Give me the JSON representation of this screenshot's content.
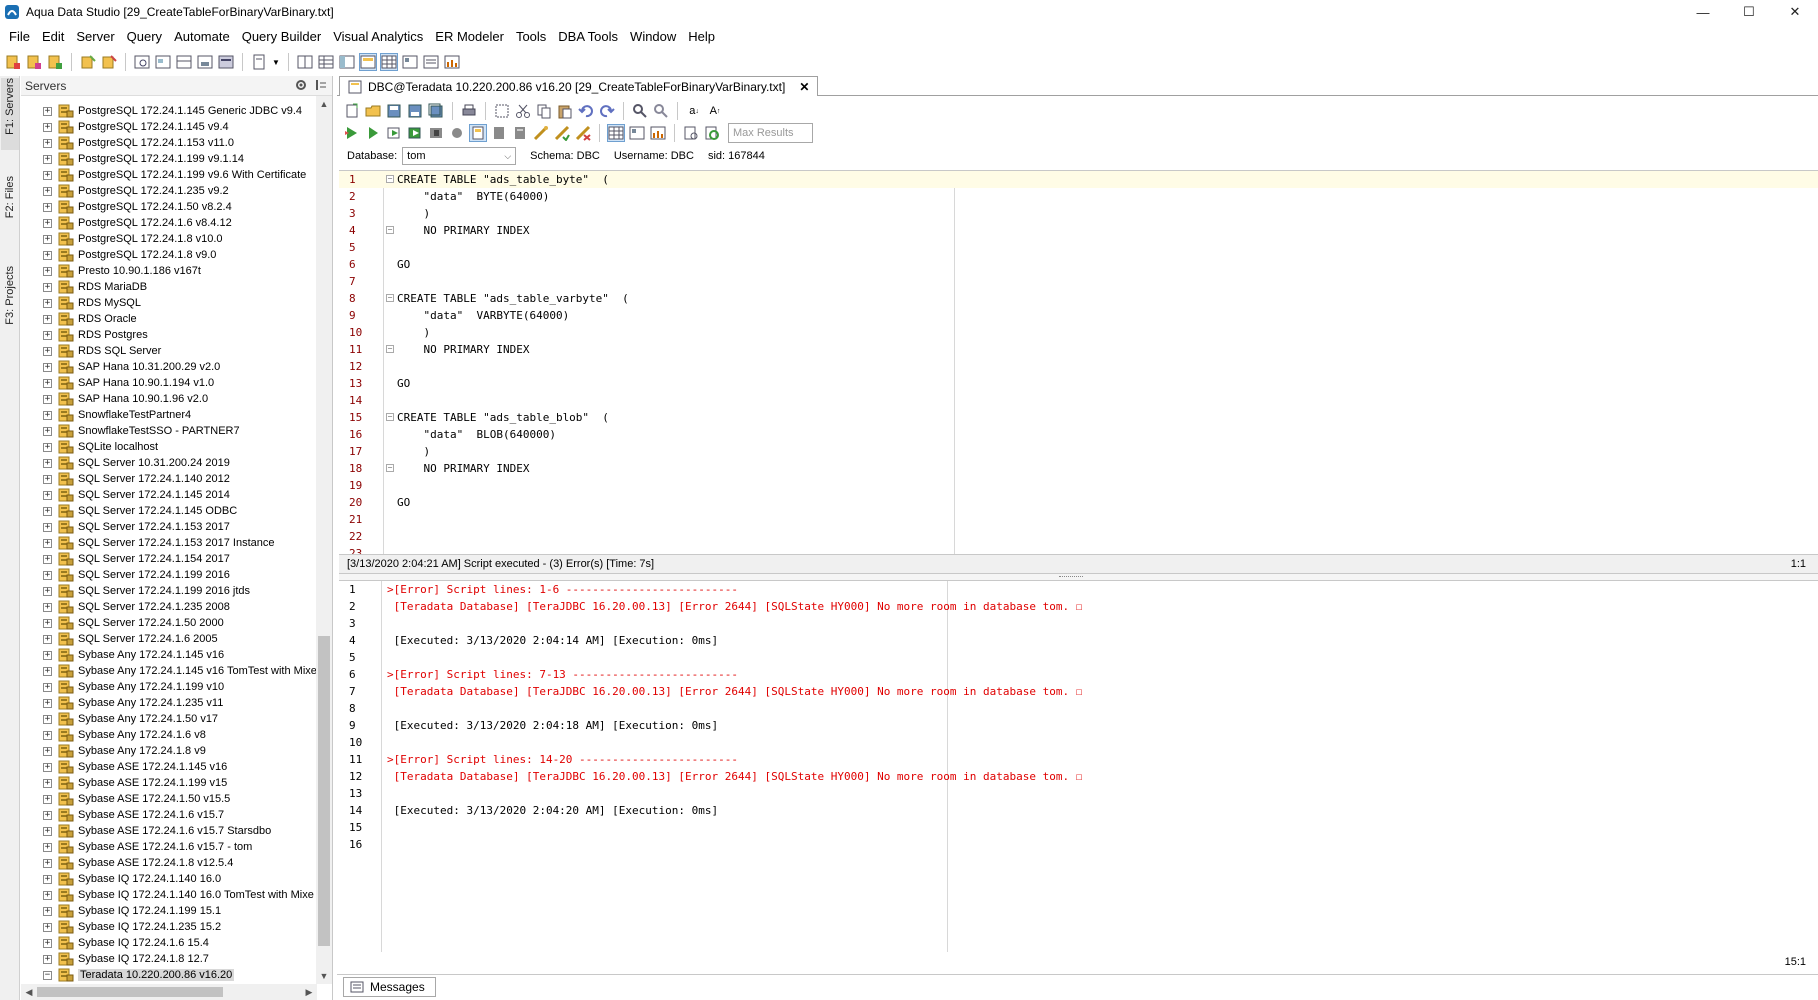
{
  "window": {
    "title": "Aqua Data Studio [29_CreateTableForBinaryVarBinary.txt]",
    "controls": {
      "minimize": "—",
      "maximize": "☐",
      "close": "✕"
    }
  },
  "menu": [
    "File",
    "Edit",
    "Server",
    "Query",
    "Automate",
    "Query Builder",
    "Visual Analytics",
    "ER Modeler",
    "Tools",
    "DBA Tools",
    "Window",
    "Help"
  ],
  "side_tabs": {
    "servers": "F1: Servers",
    "files": "F2: Files",
    "projects": "F3: Projects"
  },
  "servers_panel": {
    "title": "Servers",
    "items": [
      "PostgreSQL 172.24.1.145 Generic JDBC v9.4",
      "PostgreSQL 172.24.1.145 v9.4",
      "PostgreSQL 172.24.1.153 v11.0",
      "PostgreSQL 172.24.1.199 v9.1.14",
      "PostgreSQL 172.24.1.199 v9.6 With Certificate",
      "PostgreSQL 172.24.1.235 v9.2",
      "PostgreSQL 172.24.1.50 v8.2.4",
      "PostgreSQL 172.24.1.6 v8.4.12",
      "PostgreSQL 172.24.1.8 v10.0",
      "PostgreSQL 172.24.1.8 v9.0",
      "Presto 10.90.1.186 v167t",
      "RDS MariaDB",
      "RDS MySQL",
      "RDS Oracle",
      "RDS Postgres",
      "RDS SQL Server",
      "SAP Hana 10.31.200.29 v2.0",
      "SAP Hana 10.90.1.194 v1.0",
      "SAP Hana 10.90.1.96 v2.0",
      "SnowflakeTestPartner4",
      "SnowflakeTestSSO - PARTNER7",
      "SQLite localhost",
      "SQL Server 10.31.200.24 2019",
      "SQL Server 172.24.1.140 2012",
      "SQL Server 172.24.1.145 2014",
      "SQL Server 172.24.1.145 ODBC",
      "SQL Server 172.24.1.153 2017",
      "SQL Server 172.24.1.153 2017 Instance",
      "SQL Server 172.24.1.154 2017",
      "SQL Server 172.24.1.199 2016",
      "SQL Server 172.24.1.199 2016 jtds",
      "SQL Server 172.24.1.235 2008",
      "SQL Server 172.24.1.50 2000",
      "SQL Server 172.24.1.6 2005",
      "Sybase Any 172.24.1.145 v16",
      "Sybase Any 172.24.1.145 v16 TomTest with Mixe",
      "Sybase Any 172.24.1.199 v10",
      "Sybase Any 172.24.1.235 v11",
      "Sybase Any 172.24.1.50 v17",
      "Sybase Any 172.24.1.6 v8",
      "Sybase Any 172.24.1.8 v9",
      "Sybase ASE 172.24.1.145 v16",
      "Sybase ASE 172.24.1.199 v15",
      "Sybase ASE 172.24.1.50 v15.5",
      "Sybase ASE 172.24.1.6 v15.7",
      "Sybase ASE 172.24.1.6 v15.7 Starsdbo",
      "Sybase ASE 172.24.1.6 v15.7 - tom",
      "Sybase ASE 172.24.1.8 v12.5.4",
      "Sybase IQ 172.24.1.140 16.0",
      "Sybase IQ 172.24.1.140 16.0 TomTest with Mixe",
      "Sybase IQ 172.24.1.199 15.1",
      "Sybase IQ 172.24.1.235 15.2",
      "Sybase IQ 172.24.1.6 15.4",
      "Sybase IQ 172.24.1.8 12.7",
      "Teradata 10.220.200.86 v16.20"
    ],
    "selected": "Teradata 10.220.200.86 v16.20"
  },
  "editor": {
    "tab_title": "DBC@Teradata 10.220.200.86 v16.20 [29_CreateTableForBinaryVarBinary.txt]",
    "max_results_placeholder": "Max Results",
    "database_label": "Database:",
    "database_value": "tom",
    "schema": "Schema:  DBC",
    "username": "Username:  DBC",
    "sid": "sid:  167844",
    "lines": [
      "CREATE TABLE \"ads_table_byte\"  (",
      "    \"data\"  BYTE(64000)",
      "    )",
      "    NO PRIMARY INDEX",
      "",
      "GO",
      "",
      "CREATE TABLE \"ads_table_varbyte\"  (",
      "    \"data\"  VARBYTE(64000)",
      "    )",
      "    NO PRIMARY INDEX",
      "",
      "GO",
      "",
      "CREATE TABLE \"ads_table_blob\"  (",
      "    \"data\"  BLOB(640000)",
      "    )",
      "    NO PRIMARY INDEX",
      "",
      "GO",
      "",
      "",
      ""
    ],
    "status": "[3/13/2020 2:04:21 AM] Script executed - (3) Error(s) [Time: 7s]",
    "cursor_pos": "1:1"
  },
  "messages": {
    "lines": [
      {
        "text": ">[Error] Script lines: 1-6 --------------------------",
        "kind": "err"
      },
      {
        "text": " [Teradata Database] [TeraJDBC 16.20.00.13] [Error 2644] [SQLState HY000] No more room in database tom. ☐",
        "kind": "err"
      },
      {
        "text": "",
        "kind": "info"
      },
      {
        "text": " [Executed: 3/13/2020 2:04:14 AM] [Execution: 0ms]",
        "kind": "info"
      },
      {
        "text": "",
        "kind": "info"
      },
      {
        "text": ">[Error] Script lines: 7-13 -------------------------",
        "kind": "err"
      },
      {
        "text": " [Teradata Database] [TeraJDBC 16.20.00.13] [Error 2644] [SQLState HY000] No more room in database tom. ☐",
        "kind": "err"
      },
      {
        "text": "",
        "kind": "info"
      },
      {
        "text": " [Executed: 3/13/2020 2:04:18 AM] [Execution: 0ms]",
        "kind": "info"
      },
      {
        "text": "",
        "kind": "info"
      },
      {
        "text": ">[Error] Script lines: 14-20 ------------------------",
        "kind": "err"
      },
      {
        "text": " [Teradata Database] [TeraJDBC 16.20.00.13] [Error 2644] [SQLState HY000] No more room in database tom. ☐",
        "kind": "err"
      },
      {
        "text": "",
        "kind": "info"
      },
      {
        "text": " [Executed: 3/13/2020 2:04:20 AM] [Execution: 0ms]",
        "kind": "info"
      },
      {
        "text": "",
        "kind": "info"
      },
      {
        "text": "",
        "kind": "info"
      }
    ],
    "cursor_pos": "15:1",
    "tab_label": "Messages"
  },
  "colors": {
    "error_text": "#e00000",
    "line_number": "#8b0000",
    "current_line": "#fffce6"
  }
}
